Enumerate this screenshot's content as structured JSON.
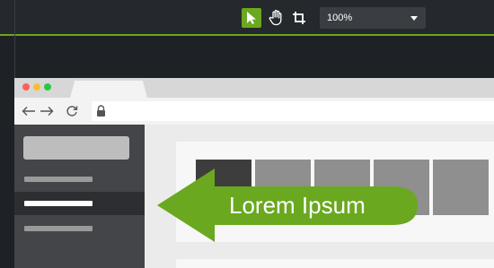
{
  "editor": {
    "tools": [
      {
        "name": "select",
        "icon": "cursor-arrow-icon",
        "active": true
      },
      {
        "name": "pan",
        "icon": "hand-icon",
        "active": false
      },
      {
        "name": "crop",
        "icon": "crop-icon",
        "active": false
      }
    ],
    "zoom": {
      "value": "100%",
      "icon": "caret-down-icon"
    }
  },
  "browser": {
    "window_controls": [
      "close",
      "minimize",
      "maximize"
    ],
    "nav": {
      "back_icon": "arrow-left-icon",
      "forward_icon": "arrow-right-icon",
      "reload_icon": "reload-icon",
      "lock_icon": "lock-icon"
    }
  },
  "callout": {
    "text": "Lorem Ipsum"
  },
  "colors": {
    "accent_green": "#6aa820",
    "editor_bg": "#1e2125",
    "sidebar_bg": "#444548",
    "dot_red": "#ff5f57",
    "dot_yellow": "#febc2e",
    "dot_green": "#28c840"
  }
}
